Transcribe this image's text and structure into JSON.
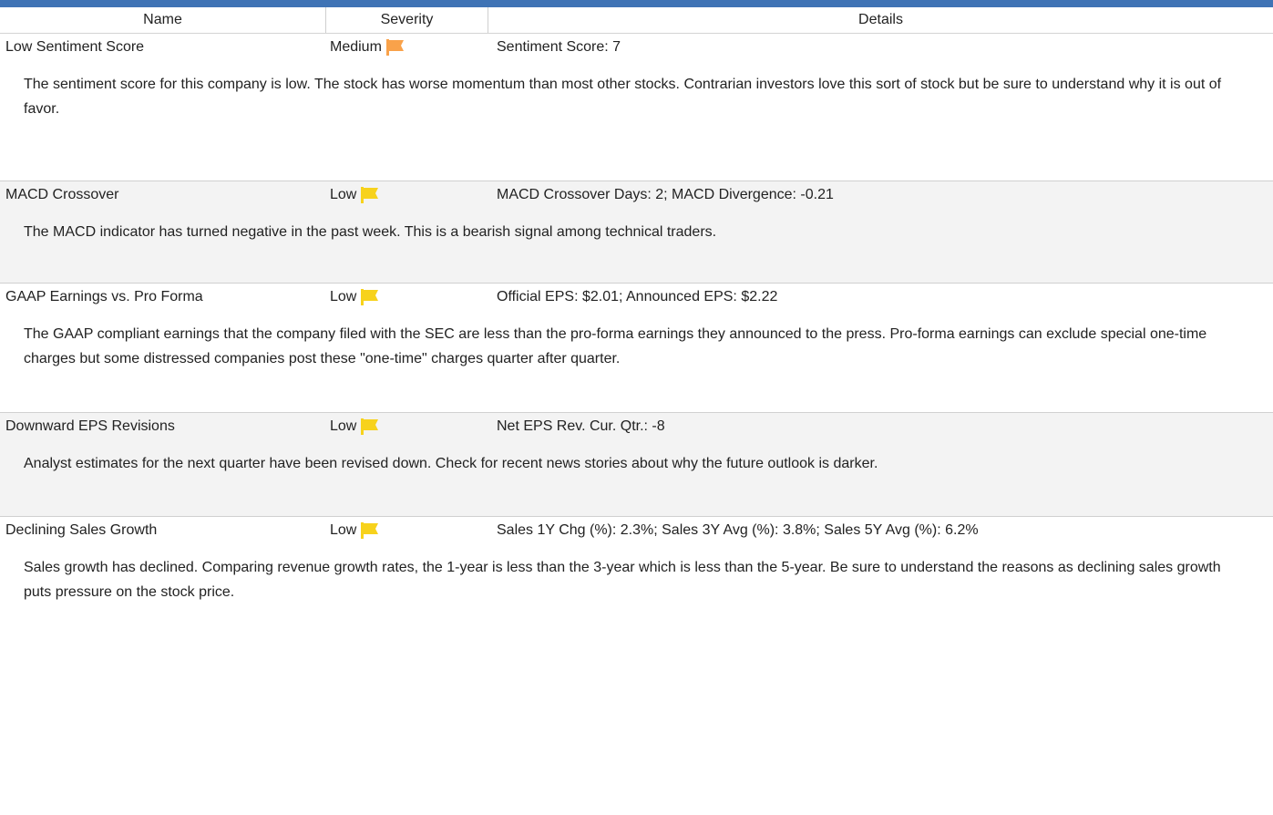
{
  "colors": {
    "top_bar": "#3f73b5",
    "flag_medium": "#f9a24a",
    "flag_low": "#f7d21c",
    "row_alt_bg": "#f3f3f3"
  },
  "header": {
    "name": "Name",
    "severity": "Severity",
    "details": "Details"
  },
  "rows": [
    {
      "name": "Low Sentiment Score",
      "severity": "Medium",
      "flag_icon": "flag-icon",
      "details": "Sentiment Score: 7",
      "description": "The sentiment score for this company is low. The stock has worse momentum than most other stocks. Contrarian investors love this sort of stock but be sure to understand why it is out of favor."
    },
    {
      "name": "MACD Crossover",
      "severity": "Low",
      "flag_icon": "flag-icon",
      "details": "MACD Crossover Days: 2;  MACD Divergence: -0.21",
      "description": "The MACD indicator has turned negative in the past week. This is a bearish signal among technical traders."
    },
    {
      "name": "GAAP Earnings vs. Pro Forma",
      "severity": "Low",
      "flag_icon": "flag-icon",
      "details": "Official EPS: $2.01;  Announced EPS: $2.22",
      "description": "The GAAP compliant earnings that the company filed with the SEC are less than the pro-forma earnings they announced to the press. Pro-forma earnings can exclude special one-time charges but some distressed companies post these \"one-time\" charges quarter after quarter."
    },
    {
      "name": "Downward EPS Revisions",
      "severity": "Low",
      "flag_icon": "flag-icon",
      "details": "Net EPS Rev. Cur. Qtr.: -8",
      "description": "Analyst estimates for the next quarter have been revised down. Check for recent news stories about why the future outlook is darker."
    },
    {
      "name": "Declining Sales Growth",
      "severity": "Low",
      "flag_icon": "flag-icon",
      "details": "Sales 1Y Chg (%): 2.3%;  Sales 3Y Avg (%): 3.8%;  Sales 5Y Avg (%): 6.2%",
      "description": "Sales growth has declined. Comparing revenue growth rates, the 1-year is less than the 3-year which is less than the 5-year. Be sure to understand the reasons as declining sales growth puts pressure on the stock price."
    }
  ]
}
